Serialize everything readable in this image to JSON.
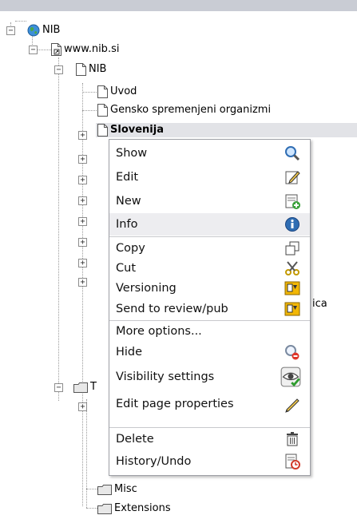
{
  "tree": {
    "root": "NIB",
    "site": "www.nib.si",
    "section": "NIB",
    "children": [
      "Uvod",
      "Gensko spremenjeni organizmi",
      "Slovenija"
    ],
    "partial_label": "ica",
    "folder_t_label": "T",
    "folders": [
      "Misc",
      "Extensions"
    ]
  },
  "toggle_symbols": {
    "collapse": "−",
    "expand": "+"
  },
  "context_menu": {
    "items": [
      {
        "label": "Show",
        "icon": "magnifier-icon"
      },
      {
        "label": "Edit",
        "icon": "edit-pencil-icon"
      },
      {
        "label": "New",
        "icon": "new-document-icon"
      },
      {
        "label": "Info",
        "icon": "info-icon"
      },
      {
        "label": "Copy",
        "icon": "copy-icon"
      },
      {
        "label": "Cut",
        "icon": "scissors-icon"
      },
      {
        "label": "Versioning",
        "icon": "versioning-icon"
      },
      {
        "label": "Send to review/pub",
        "icon": "review-icon"
      },
      {
        "label": "More options...",
        "icon": ""
      },
      {
        "label": "Hide",
        "icon": "hide-icon"
      },
      {
        "label": "Visibility settings",
        "icon": "visibility-eye-icon"
      },
      {
        "label": "Edit page properties",
        "icon": "pencil-icon"
      },
      {
        "label": "Delete",
        "icon": "trash-icon"
      },
      {
        "label": "History/Undo",
        "icon": "history-icon"
      }
    ]
  },
  "colors": {
    "menu_border": "#9ea0a6",
    "selected_row": "#e2e3e7",
    "hover_row": "#ededf0",
    "top_bar": "#c9ccd4"
  }
}
